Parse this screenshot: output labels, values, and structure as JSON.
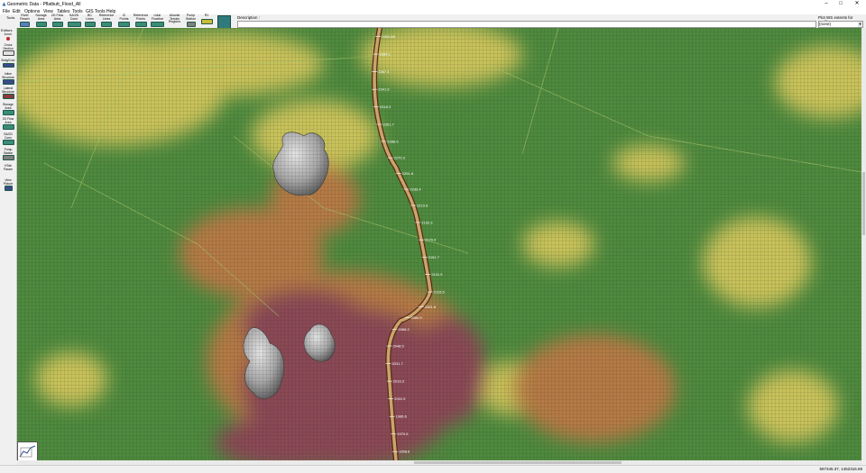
{
  "window": {
    "title": "Geometric Data - Pflatbutt_Flood_All",
    "controls": [
      "–",
      "□",
      "✕"
    ]
  },
  "menu": [
    "File",
    "Edit",
    "Options",
    "View",
    "Tables",
    "Tools",
    "GIS Tools",
    "Help"
  ],
  "toolbar": {
    "tools_label": "Tools",
    "buttons": [
      {
        "label": "River\nReach"
      },
      {
        "label": "Storage\nArea"
      },
      {
        "label": "2D Flow\nArea"
      },
      {
        "label": "SA/2D\nConn"
      },
      {
        "label": "BC\nLines"
      },
      {
        "label": "Reference\nLines"
      },
      {
        "label": "IC\nPoints"
      },
      {
        "label": "Reference\nPoints"
      },
      {
        "label": "Lidar\nFlowline"
      },
      {
        "label": "Alluvial\nTerrain\nRegions"
      },
      {
        "label": "Pump\nStation"
      },
      {
        "label": "R1"
      }
    ],
    "description_label": "Description :",
    "description_value": "",
    "plot_label": "Plot WS extents for Profile:",
    "plot_value": "(none)"
  },
  "editors": {
    "header": "Editors",
    "items": [
      {
        "label": "Junct."
      },
      {
        "label": "Cross\nSection"
      },
      {
        "label": "Brdg/Culv"
      },
      {
        "label": "Inline\nStructure"
      },
      {
        "label": "Lateral\nStructure"
      },
      {
        "label": "Storage\nArea"
      },
      {
        "label": "2D Flow\nArea"
      },
      {
        "label": "SA/2D\nConn"
      },
      {
        "label": "Pump\nStation"
      },
      {
        "label": "HTab\nParam"
      },
      {
        "label": "View\nPicture"
      }
    ]
  },
  "map": {
    "river_stations": [
      "2401.68",
      "2386.1",
      "2367.4",
      "2341.9",
      "2318.3",
      "2301.7",
      "2286.6",
      "2270.3",
      "2251.8",
      "2233.4",
      "2210.6",
      "2192.3",
      "2170.4",
      "2151.7",
      "2131.5",
      "2115.5",
      "2101.8",
      "2084.9",
      "2066.2",
      "2048.5",
      "2031.7",
      "2016.3",
      "2001.9",
      "1986.6",
      "1970.6",
      "1958.6"
    ],
    "colors": {
      "green": "#4e8a3e",
      "yellow": "#c9c25a",
      "orange": "#b57a45",
      "maroon": "#8a4a55",
      "river": "#c9a56a"
    }
  },
  "status": {
    "coordinates": "597345.37, 1452316.69"
  }
}
